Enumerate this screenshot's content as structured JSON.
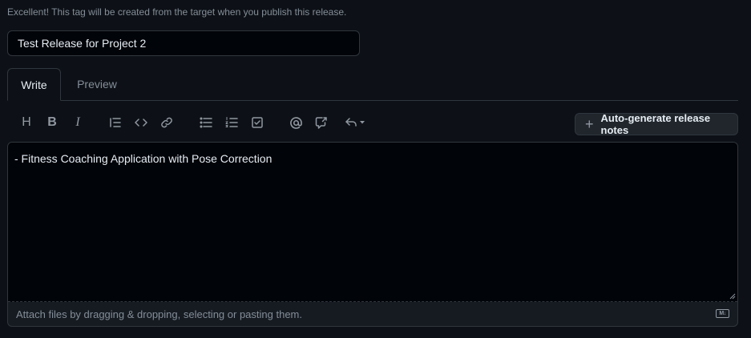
{
  "tag_hint": "Excellent! This tag will be created from the target when you publish this release.",
  "release_title": {
    "value": "Test Release for Project 2",
    "placeholder": ""
  },
  "tabs": [
    {
      "label": "Write",
      "active": true
    },
    {
      "label": "Preview",
      "active": false
    }
  ],
  "toolbar": {
    "heading_glyph": "H",
    "bold_glyph": "B",
    "italic_glyph": "I",
    "auto_generate_label": "Auto-generate release notes",
    "auto_generate_icon": "+"
  },
  "editor": {
    "body": "- Fitness Coaching Application with Pose Correction",
    "attach_text": "Attach files by dragging & dropping, selecting or pasting them.",
    "markdown_badge": "M↓"
  },
  "colors": {
    "background": "#0d1117",
    "input_background": "#010409",
    "border": "#30363d",
    "muted_text": "#848d97",
    "primary_text": "#e6edf3",
    "button_background": "#21262d"
  }
}
